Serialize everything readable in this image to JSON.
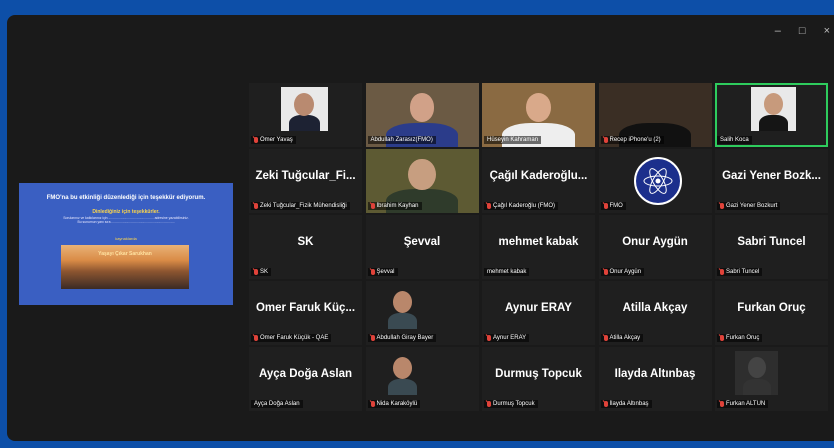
{
  "window": {
    "minimize": "–",
    "maximize": "□",
    "close": "×"
  },
  "share": {
    "line1": "FMO'na bu etkinliği düzenlediği için teşekkür ediyorum.",
    "line2": "Dinlediğiniz için teşekkürler.",
    "line3": "Sorularınız ve katkılarınız için ................................................ adresine yazabilirsiniz.",
    "line4": "Bu sunumun yanı sıra ...................................................................",
    "line5": "kaynaklarda",
    "caption": "Yaşayı Çıkar Sarukhan"
  },
  "tiles": [
    {
      "name": "Ömer Yavaş",
      "display": "",
      "video": true,
      "muted": true,
      "active": false
    },
    {
      "name": "Abdullah Zarasız(FMO)",
      "display": "",
      "video": true,
      "muted": false,
      "active": false
    },
    {
      "name": "Hüseyin Kahraman",
      "display": "",
      "video": true,
      "muted": false,
      "active": false
    },
    {
      "name": "Recep iPhone'u (2)",
      "display": "",
      "video": true,
      "muted": true,
      "active": false
    },
    {
      "name": "Salih Koca",
      "display": "",
      "video": true,
      "muted": false,
      "active": true
    },
    {
      "name": "Zeki Tuğcular_Fizik Mühendisliği",
      "display": "Zeki Tuğcular_Fi...",
      "video": false,
      "muted": true
    },
    {
      "name": "İbrahim Kayhan",
      "display": "",
      "video": true,
      "muted": true
    },
    {
      "name": "Çağıl Kaderoğlu (FMO)",
      "display": "Çağıl Kaderoğlu...",
      "video": false,
      "muted": true
    },
    {
      "name": "FMO",
      "display": "",
      "video": true,
      "muted": true
    },
    {
      "name": "Gazi Yener Bozkurt",
      "display": "Gazi Yener Bozk...",
      "video": false,
      "muted": true
    },
    {
      "name": "SK",
      "display": "SK",
      "video": false,
      "muted": true
    },
    {
      "name": "Şevval",
      "display": "Şevval",
      "video": false,
      "muted": true
    },
    {
      "name": "mehmet kabak",
      "display": "mehmet kabak",
      "video": false,
      "muted": false
    },
    {
      "name": "Onur Aygün",
      "display": "Onur Aygün",
      "video": false,
      "muted": true
    },
    {
      "name": "Sabri Tuncel",
      "display": "Sabri Tuncel",
      "video": false,
      "muted": true
    },
    {
      "name": "Ömer Faruk Küçük - QAE",
      "display": "Ömer Faruk Küç...",
      "video": false,
      "muted": true
    },
    {
      "name": "Abdullah Giray Bayer",
      "display": "",
      "video": true,
      "muted": true
    },
    {
      "name": "Aynur ERAY",
      "display": "Aynur ERAY",
      "video": false,
      "muted": true
    },
    {
      "name": "Atilla Akçay",
      "display": "Atilla Akçay",
      "video": false,
      "muted": true
    },
    {
      "name": "Furkan Oruç",
      "display": "Furkan Oruç",
      "video": false,
      "muted": true
    },
    {
      "name": "Ayça Doğa Aslan",
      "display": "Ayça Doğa Aslan",
      "video": false,
      "muted": false
    },
    {
      "name": "Nida Karaköylü",
      "display": "",
      "video": true,
      "muted": true
    },
    {
      "name": "Durmuş Topcuk",
      "display": "Durmuş Topcuk",
      "video": false,
      "muted": true
    },
    {
      "name": "İlayda Altınbaş",
      "display": "İlayda Altınbaş",
      "video": false,
      "muted": true
    },
    {
      "name": "Furkan ALTUN",
      "display": "",
      "video": true,
      "muted": true
    }
  ]
}
